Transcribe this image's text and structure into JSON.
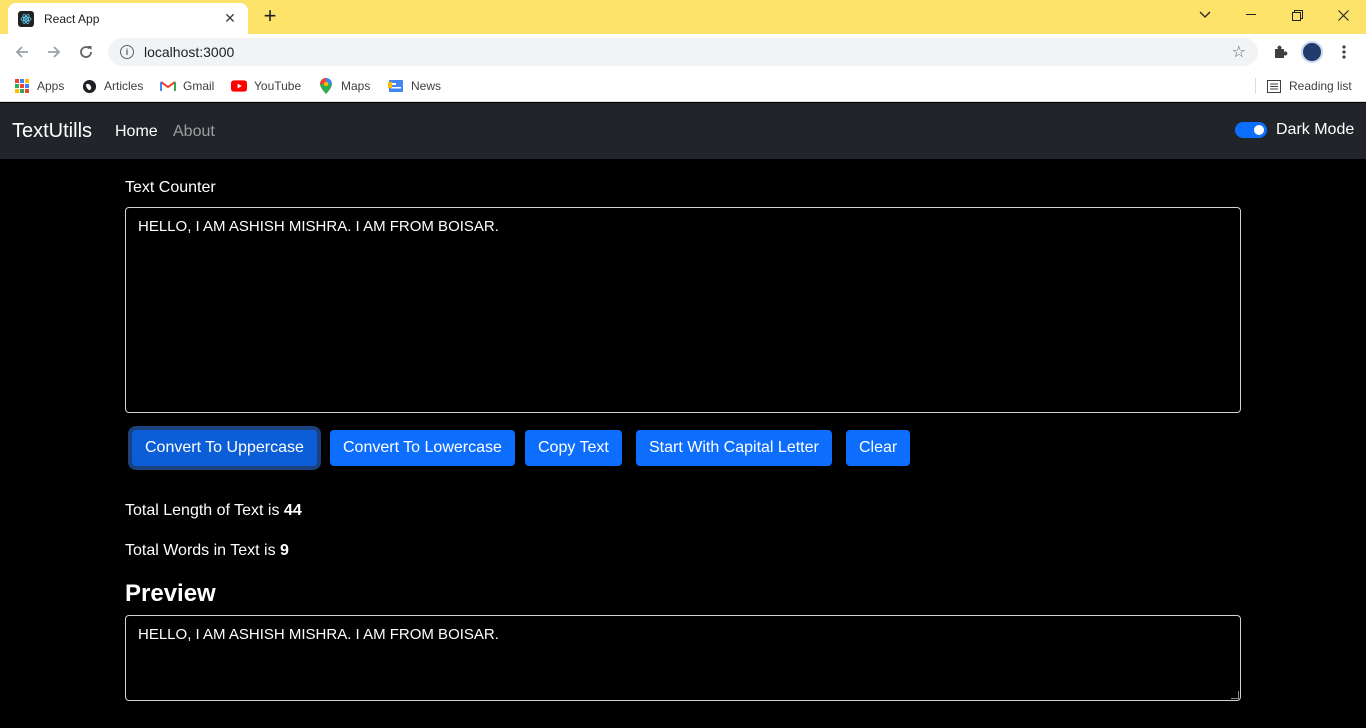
{
  "browser": {
    "tab_title": "React App",
    "url": "localhost:3000",
    "bookmarks": [
      {
        "label": "Apps",
        "icon": "apps-grid-icon"
      },
      {
        "label": "Articles",
        "icon": "globe-icon"
      },
      {
        "label": "Gmail",
        "icon": "gmail-icon"
      },
      {
        "label": "YouTube",
        "icon": "youtube-icon"
      },
      {
        "label": "Maps",
        "icon": "maps-pin-icon"
      },
      {
        "label": "News",
        "icon": "news-icon"
      }
    ],
    "reading_list": "Reading list",
    "frame_color": "#fde36a"
  },
  "navbar": {
    "brand": "TextUtills",
    "links": [
      "Home",
      "About"
    ],
    "toggle_label": "Dark Mode",
    "toggle_on": true,
    "background": "#212529"
  },
  "form": {
    "label": "Text Counter",
    "text": "HELLO, I AM ASHISH MISHRA. I AM FROM BOISAR."
  },
  "buttons": [
    "Convert To Uppercase",
    "Convert To Lowercase",
    "Copy Text",
    "Start With Capital Letter",
    "Clear"
  ],
  "stats": {
    "length_prefix": "Total Length of Text is",
    "length_value": "44",
    "words_prefix": "Total Words in Text is",
    "words_value": "9"
  },
  "preview": {
    "title": "Preview",
    "text": "HELLO, I AM ASHISH MISHRA. I AM FROM BOISAR."
  },
  "colors": {
    "primary": "#0d6efd",
    "page_background": "#000000"
  }
}
